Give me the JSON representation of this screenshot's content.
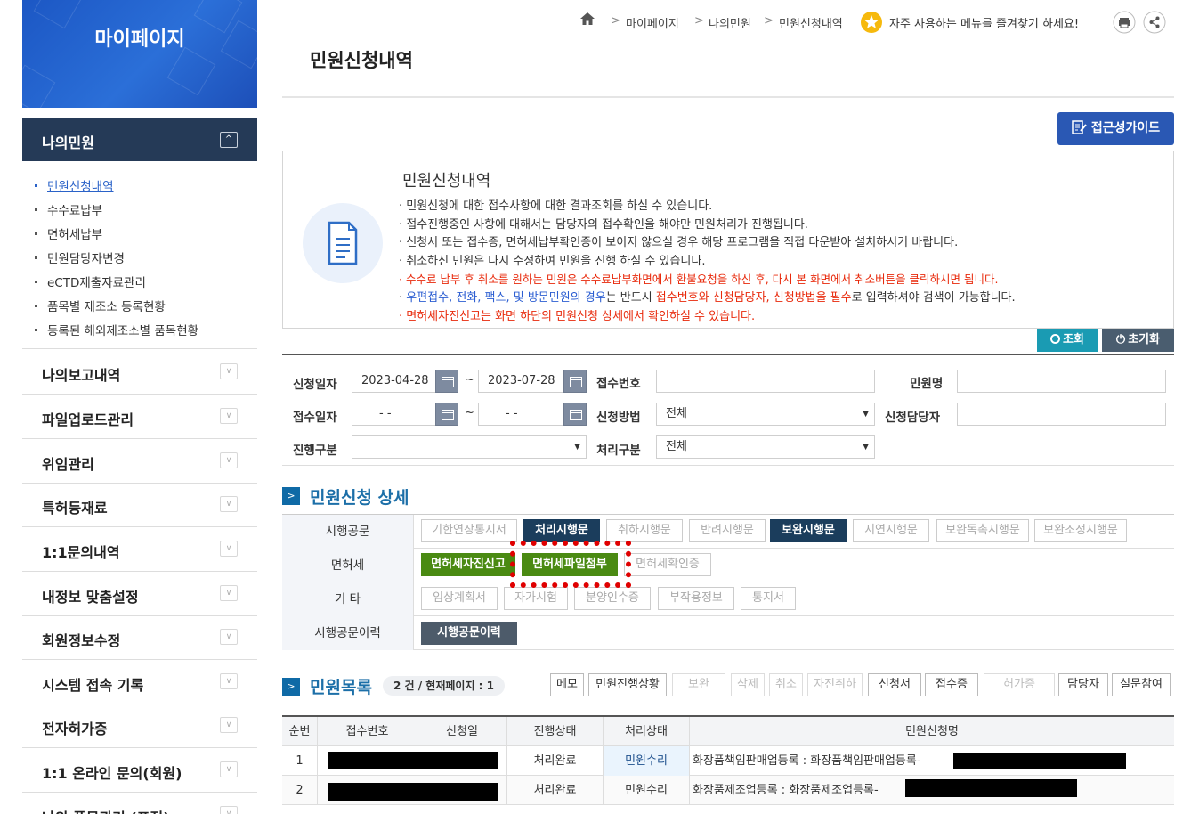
{
  "sidebar": {
    "title": "마이페이지",
    "section": {
      "label": "나의민원",
      "toggle": "^"
    },
    "sub_items": [
      "민원신청내역",
      "수수료납부",
      "면허세납부",
      "민원담당자변경",
      "eCTD제출자료관리",
      "품목별 제조소 등록현황",
      "등록된 해외제조소별 품목현황"
    ],
    "menu": [
      "나의보고내역",
      "파일업로드관리",
      "위임관리",
      "특허등재료",
      "1:1문의내역",
      "내정보 맞춤설정",
      "회원정보수정",
      "시스템 접속 기록",
      "전자허가증",
      "1:1 온라인 문의(회원)",
      "나의 품목관리 (표적)"
    ]
  },
  "breadcrumb": {
    "items": [
      "마이페이지",
      "나의민원",
      "민원신청내역"
    ],
    "favorite_text": "자주 사용하는 메뉴를 즐겨찾기 하세요!"
  },
  "page": {
    "title": "민원신청내역",
    "guide_button": "접근성가이드"
  },
  "info": {
    "title": "민원신청내역",
    "lines": [
      {
        "text": "· 민원신청에 대한 접수사항에 대한 결과조회를 하실 수 있습니다.",
        "color": "#333333"
      },
      {
        "text": "· 접수진행중인 사항에 대해서는 담당자의 접수확인을 해야만 민원처리가 진행됩니다.",
        "color": "#333333"
      },
      {
        "text": "· 신청서 또는 접수증, 면허세납부확인증이 보이지 않으실 경우 해당 프로그램을 직접 다운받아 설치하시기 바랍니다.",
        "color": "#333333"
      },
      {
        "text": "· 취소하신 민원은 다시 수정하여 민원을 진행 하실 수 있습니다.",
        "color": "#333333"
      },
      {
        "text": "· 수수료 납부 후 취소를 원하는 민원은 수수료납부화면에서 환불요청을 하신 후, 다시 본 화면에서 취소버튼을 클릭하시면 됩니다.",
        "color": "#e8290b"
      },
      {
        "text": "· 면허세자진신고는 화면 하단의 민원신청 상세에서 확인하실 수 있습니다.",
        "color": "#e8290b"
      }
    ],
    "line6": {
      "prefix": "· ",
      "red1": "우편접수, 전화, 팩스, 및 방문민원의 경우",
      "mid": "는 반드시 ",
      "red2": "접수번호와 신청담당자, 신청방법을 필수",
      "suffix": "로 입력하셔야 검색이 가능합니다."
    }
  },
  "actions": {
    "search": "조회",
    "reset": "초기화"
  },
  "form": {
    "apply_date_label": "신청일자",
    "apply_from": "2023-04-28",
    "apply_to": "2023-07-28",
    "receipt_no_label": "접수번호",
    "complaint_name_label": "민원명",
    "receipt_date_label": "접수일자",
    "receipt_from": "- -",
    "receipt_to": "- -",
    "method_label": "신청방법",
    "method_value": "전체",
    "manager_label": "신청담당자",
    "progress_label": "진행구분",
    "progress_value": "",
    "process_label": "처리구분",
    "process_value": "전체",
    "tilde": "~"
  },
  "detail": {
    "title": "민원신청 상세",
    "rows": [
      {
        "label": "시행공문",
        "buttons": [
          "기한연장통지서",
          "처리시행문",
          "취하시행문",
          "반려시행문",
          "보완시행문",
          "지연시행문",
          "보완독촉시행문",
          "보완조정시행문"
        ]
      },
      {
        "label": "면허세",
        "buttons": [
          "면허세자진신고",
          "면허세파일첨부",
          "면허세확인증"
        ]
      },
      {
        "label": "기 타",
        "buttons": [
          "임상계획서",
          "자가시험",
          "분양인수증",
          "부작용정보",
          "통지서"
        ]
      },
      {
        "label": "시행공문이력",
        "buttons": [
          "시행공문이력"
        ]
      }
    ]
  },
  "list": {
    "title": "민원목록",
    "count": "2 건 / 현재페이지 : 1",
    "buttons": [
      "메모",
      "민원진행상황",
      "보완",
      "삭제",
      "취소",
      "자진취하",
      "신청서",
      "접수증",
      "허가증",
      "담당자",
      "설문참여"
    ],
    "headers": [
      "순번",
      "접수번호",
      "신청일",
      "진행상태",
      "처리상태",
      "민원신청명"
    ],
    "rows": [
      {
        "no": "1",
        "status": "처리완료",
        "result": "민원수리",
        "name": "화장품책임판매업등록 : 화장품책임판매업등록-"
      },
      {
        "no": "2",
        "status": "처리완료",
        "result": "민원수리",
        "name": "화장품제조업등록 : 화장품제조업등록-"
      }
    ]
  }
}
